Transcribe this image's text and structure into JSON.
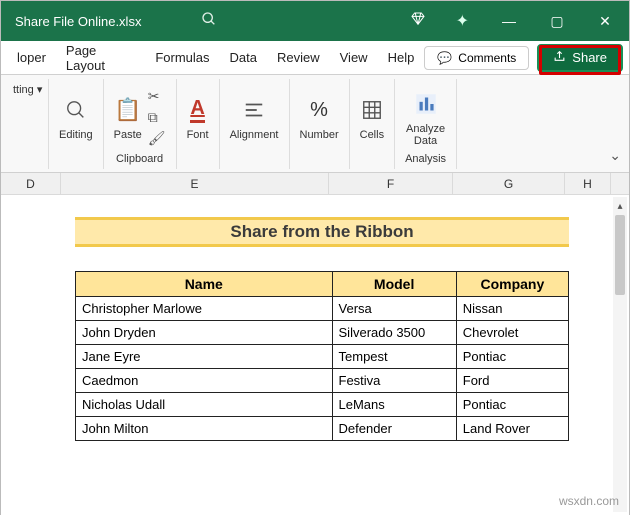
{
  "titlebar": {
    "filename": "Share File Online.xlsx"
  },
  "tabs": {
    "developer": "loper",
    "pagelayout": "Page Layout",
    "formulas": "Formulas",
    "data": "Data",
    "review": "Review",
    "view": "View",
    "help": "Help"
  },
  "actions": {
    "comments": "Comments",
    "share": "Share"
  },
  "ribbon": {
    "tting": "tting",
    "editing": "Editing",
    "paste": "Paste",
    "clipboard": "Clipboard",
    "font": "Font",
    "alignment": "Alignment",
    "number": "Number",
    "cells": "Cells",
    "analyze": "Analyze\nData",
    "analysis": "Analysis"
  },
  "sheet": {
    "cols": {
      "d": "D",
      "e": "E",
      "f": "F",
      "g": "G",
      "h": "H"
    },
    "title": "Share from the Ribbon",
    "headers": {
      "name": "Name",
      "model": "Model",
      "company": "Company"
    },
    "rows": [
      {
        "name": "Christopher Marlowe",
        "model": "Versa",
        "company": "Nissan"
      },
      {
        "name": "John Dryden",
        "model": "Silverado 3500",
        "company": "Chevrolet"
      },
      {
        "name": "Jane Eyre",
        "model": "Tempest",
        "company": "Pontiac"
      },
      {
        "name": "Caedmon",
        "model": "Festiva",
        "company": "Ford"
      },
      {
        "name": "Nicholas Udall",
        "model": "LeMans",
        "company": "Pontiac"
      },
      {
        "name": "John Milton",
        "model": "Defender",
        "company": "Land Rover"
      }
    ]
  },
  "watermark": "wsxdn.com"
}
